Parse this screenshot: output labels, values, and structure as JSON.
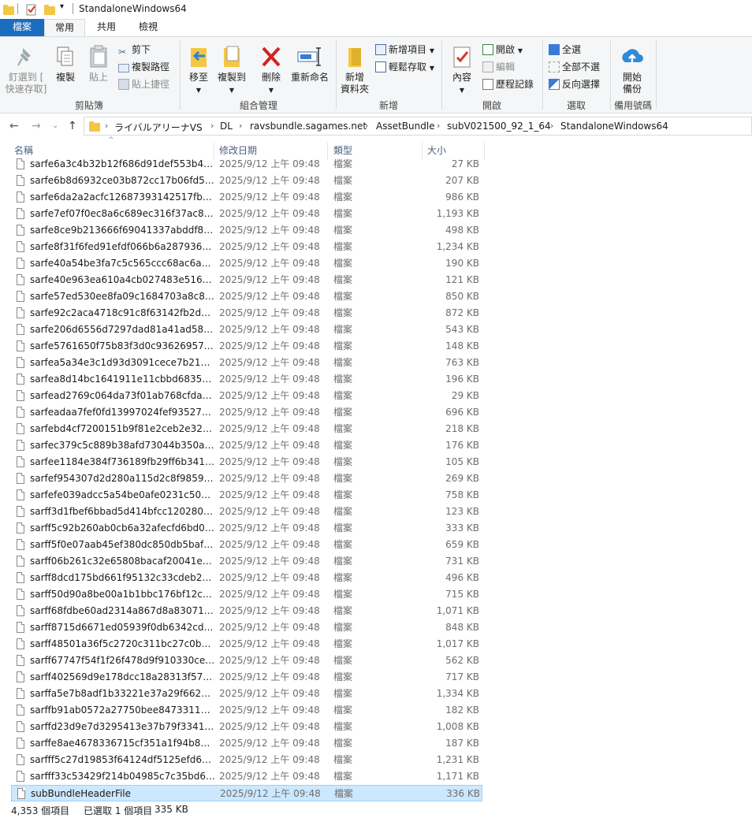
{
  "window": {
    "title": "StandaloneWindows64"
  },
  "tabs": {
    "file": "檔案",
    "home": "常用",
    "share": "共用",
    "view": "檢視"
  },
  "ribbon": {
    "clipboard": {
      "label": "剪貼簿",
      "pin": "釘選到 [",
      "pin2": "快速存取]",
      "copy": "複製",
      "paste": "貼上",
      "cut": "剪下",
      "copy_path": "複製路徑",
      "paste_shortcut": "貼上捷徑"
    },
    "organize": {
      "label": "組合管理",
      "move_to": "移至",
      "copy_to": "複製到",
      "delete": "刪除",
      "rename": "重新命名"
    },
    "new": {
      "label": "新增",
      "new_folder": "新增",
      "new_folder2": "資料夾",
      "new_item": "新增項目",
      "easy_access": "輕鬆存取"
    },
    "open": {
      "label": "開啟",
      "properties": "內容",
      "open": "開啟",
      "edit": "編輯",
      "history": "歷程記錄"
    },
    "select": {
      "label": "選取",
      "select_all": "全選",
      "select_none": "全部不選",
      "invert": "反向選擇"
    },
    "backup": {
      "label": "備用號碼",
      "start": "開始",
      "backup": "備份"
    }
  },
  "address": {
    "crumbs": [
      "ライバルアリーナVS",
      "DL",
      "ravsbundle.sagames.net",
      "AssetBundle",
      "subV021500_92_1_64",
      "StandaloneWindows64"
    ]
  },
  "columns": {
    "name": "名稱",
    "date": "修改日期",
    "type": "類型",
    "size": "大小"
  },
  "files": [
    {
      "name": "sarfe6a3c4b32b12f686d91def553b45...",
      "date": "2025/9/12 上午 09:48",
      "type": "檔案",
      "size": "27 KB"
    },
    {
      "name": "sarfe6b8d6932ce03b872cc17b06fd5a...",
      "date": "2025/9/12 上午 09:48",
      "type": "檔案",
      "size": "207 KB"
    },
    {
      "name": "sarfe6da2a2acfc12687393142517fb29...",
      "date": "2025/9/12 上午 09:48",
      "type": "檔案",
      "size": "986 KB"
    },
    {
      "name": "sarfe7ef07f0ec8a6c689ec316f37ac82...",
      "date": "2025/9/12 上午 09:48",
      "type": "檔案",
      "size": "1,193 KB"
    },
    {
      "name": "sarfe8ce9b213666f69041337abddf85...",
      "date": "2025/9/12 上午 09:48",
      "type": "檔案",
      "size": "498 KB"
    },
    {
      "name": "sarfe8f31f6fed91efdf066b6a2879363c...",
      "date": "2025/9/12 上午 09:48",
      "type": "檔案",
      "size": "1,234 KB"
    },
    {
      "name": "sarfe40a54be3fa7c5c565ccc68ac6aac...",
      "date": "2025/9/12 上午 09:48",
      "type": "檔案",
      "size": "190 KB"
    },
    {
      "name": "sarfe40e963ea610a4cb027483e5163f...",
      "date": "2025/9/12 上午 09:48",
      "type": "檔案",
      "size": "121 KB"
    },
    {
      "name": "sarfe57ed530ee8fa09c1684703a8c84...",
      "date": "2025/9/12 上午 09:48",
      "type": "檔案",
      "size": "850 KB"
    },
    {
      "name": "sarfe92c2aca4718c91c8f63142fb2d7a...",
      "date": "2025/9/12 上午 09:48",
      "type": "檔案",
      "size": "872 KB"
    },
    {
      "name": "sarfe206d6556d7297dad81a41ad587...",
      "date": "2025/9/12 上午 09:48",
      "type": "檔案",
      "size": "543 KB"
    },
    {
      "name": "sarfe5761650f75b83f3d0c93626957a...",
      "date": "2025/9/12 上午 09:48",
      "type": "檔案",
      "size": "148 KB"
    },
    {
      "name": "sarfea5a34e3c1d93d3091cece7b2133...",
      "date": "2025/9/12 上午 09:48",
      "type": "檔案",
      "size": "763 KB"
    },
    {
      "name": "sarfea8d14bc1641911e11cbbd68352...",
      "date": "2025/9/12 上午 09:48",
      "type": "檔案",
      "size": "196 KB"
    },
    {
      "name": "sarfead2769c064da73f01ab768cfda0...",
      "date": "2025/9/12 上午 09:48",
      "type": "檔案",
      "size": "29 KB"
    },
    {
      "name": "sarfeadaa7fef0fd13997024fef935277a...",
      "date": "2025/9/12 上午 09:48",
      "type": "檔案",
      "size": "696 KB"
    },
    {
      "name": "sarfebd4cf7200151b9f81e2ceb2e32b...",
      "date": "2025/9/12 上午 09:48",
      "type": "檔案",
      "size": "218 KB"
    },
    {
      "name": "sarfec379c5c889b38afd73044b350aa...",
      "date": "2025/9/12 上午 09:48",
      "type": "檔案",
      "size": "176 KB"
    },
    {
      "name": "sarfee1184e384f736189fb29ff6b3418...",
      "date": "2025/9/12 上午 09:48",
      "type": "檔案",
      "size": "105 KB"
    },
    {
      "name": "sarfef954307d2d280a115d2c8f98590...",
      "date": "2025/9/12 上午 09:48",
      "type": "檔案",
      "size": "269 KB"
    },
    {
      "name": "sarfefe039adcc5a54be0afe0231c509d...",
      "date": "2025/9/12 上午 09:48",
      "type": "檔案",
      "size": "758 KB"
    },
    {
      "name": "sarff3d1fbef6bbad5d414bfcc1202803...",
      "date": "2025/9/12 上午 09:48",
      "type": "檔案",
      "size": "123 KB"
    },
    {
      "name": "sarff5c92b260ab0cb6a32afecfd6bd01...",
      "date": "2025/9/12 上午 09:48",
      "type": "檔案",
      "size": "333 KB"
    },
    {
      "name": "sarff5f0e07aab45ef380dc850db5baf0...",
      "date": "2025/9/12 上午 09:48",
      "type": "檔案",
      "size": "659 KB"
    },
    {
      "name": "sarff06b261c32e65808bacaf20041e19...",
      "date": "2025/9/12 上午 09:48",
      "type": "檔案",
      "size": "731 KB"
    },
    {
      "name": "sarff8dcd175bd661f95132c33cdeb23...",
      "date": "2025/9/12 上午 09:48",
      "type": "檔案",
      "size": "496 KB"
    },
    {
      "name": "sarff50d90a8be00a1b1bbc176bf12cd...",
      "date": "2025/9/12 上午 09:48",
      "type": "檔案",
      "size": "715 KB"
    },
    {
      "name": "sarff68fdbe60ad2314a867d8a830716...",
      "date": "2025/9/12 上午 09:48",
      "type": "檔案",
      "size": "1,071 KB"
    },
    {
      "name": "sarff8715d6671ed05939f0db6342cdb...",
      "date": "2025/9/12 上午 09:48",
      "type": "檔案",
      "size": "848 KB"
    },
    {
      "name": "sarff48501a36f5c2720c311bc27c0b4d...",
      "date": "2025/9/12 上午 09:48",
      "type": "檔案",
      "size": "1,017 KB"
    },
    {
      "name": "sarff67747f54f1f26f478d9f910330ce0...",
      "date": "2025/9/12 上午 09:48",
      "type": "檔案",
      "size": "562 KB"
    },
    {
      "name": "sarff402569d9e178dcc18a28313f5782...",
      "date": "2025/9/12 上午 09:48",
      "type": "檔案",
      "size": "717 KB"
    },
    {
      "name": "sarffa5e7b8adf1b33221e37a29f66267...",
      "date": "2025/9/12 上午 09:48",
      "type": "檔案",
      "size": "1,334 KB"
    },
    {
      "name": "sarffb91ab0572a27750bee8473311b0...",
      "date": "2025/9/12 上午 09:48",
      "type": "檔案",
      "size": "182 KB"
    },
    {
      "name": "sarffd23d9e7d3295413e37b79f3341c...",
      "date": "2025/9/12 上午 09:48",
      "type": "檔案",
      "size": "1,008 KB"
    },
    {
      "name": "sarffe8ae4678336715cf351a1f94b840...",
      "date": "2025/9/12 上午 09:48",
      "type": "檔案",
      "size": "187 KB"
    },
    {
      "name": "sarfff5c27d19853f64124df5125efd696...",
      "date": "2025/9/12 上午 09:48",
      "type": "檔案",
      "size": "1,231 KB"
    },
    {
      "name": "sarfff33c53429f214b04985c7c35bd65...",
      "date": "2025/9/12 上午 09:48",
      "type": "檔案",
      "size": "1,171 KB"
    },
    {
      "name": "subBundleHeaderFile",
      "date": "2025/9/12 上午 09:48",
      "type": "檔案",
      "size": "336 KB",
      "selected": true
    }
  ],
  "status": {
    "count": "4,353 個項目",
    "selected": "已選取 1 個項目",
    "size": "335 KB"
  },
  "colors": {
    "accent": "#1a6cbf",
    "selection": "#cce8ff",
    "header_text": "#4d6082"
  }
}
